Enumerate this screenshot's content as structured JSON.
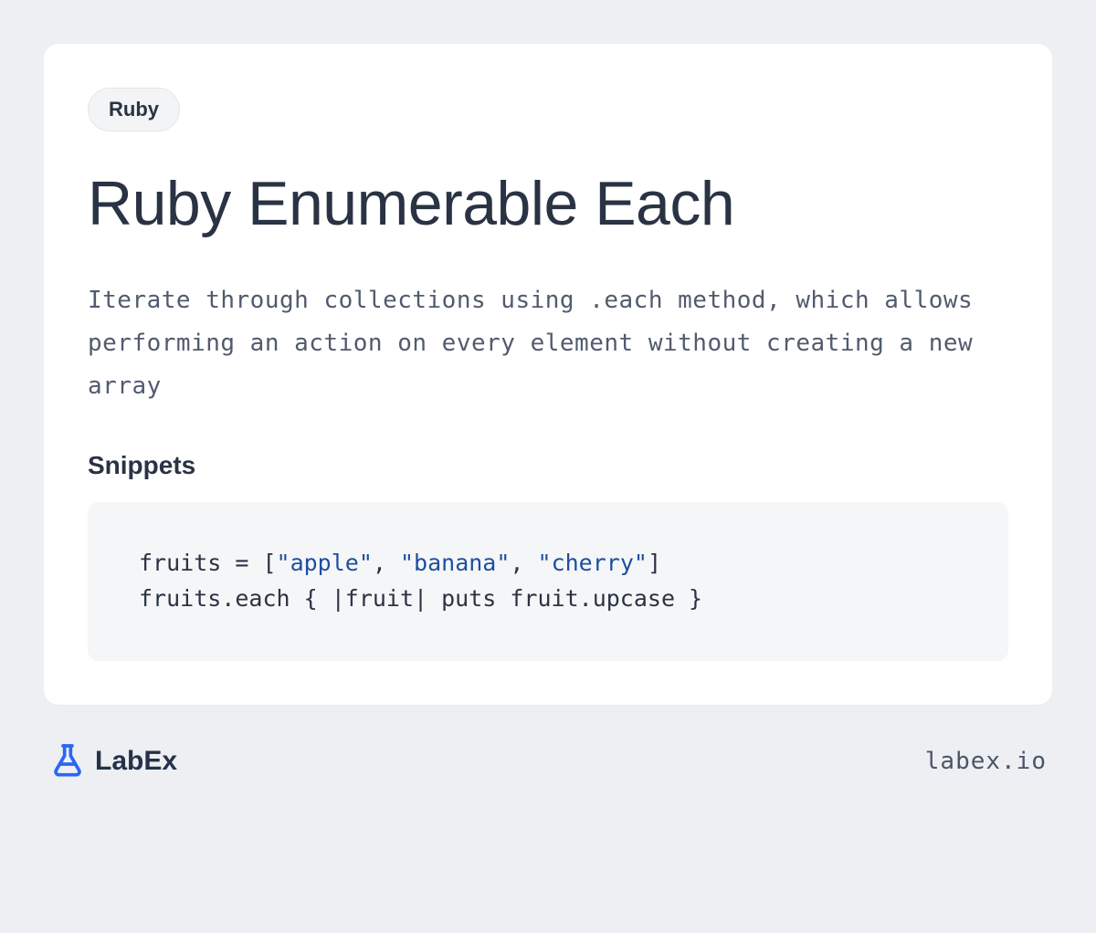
{
  "badge": "Ruby",
  "title": "Ruby Enumerable Each",
  "description": "Iterate through collections using .each method, which allows performing an action on every element without creating a new array",
  "snippets_label": "Snippets",
  "code": {
    "line1_pre": "fruits = [",
    "line1_s1": "\"apple\"",
    "line1_c1": ", ",
    "line1_s2": "\"banana\"",
    "line1_c2": ", ",
    "line1_s3": "\"cherry\"",
    "line1_post": "]",
    "line2": "fruits.each { |fruit| puts fruit.upcase }"
  },
  "footer": {
    "brand": "LabEx",
    "site": "labex.io"
  }
}
